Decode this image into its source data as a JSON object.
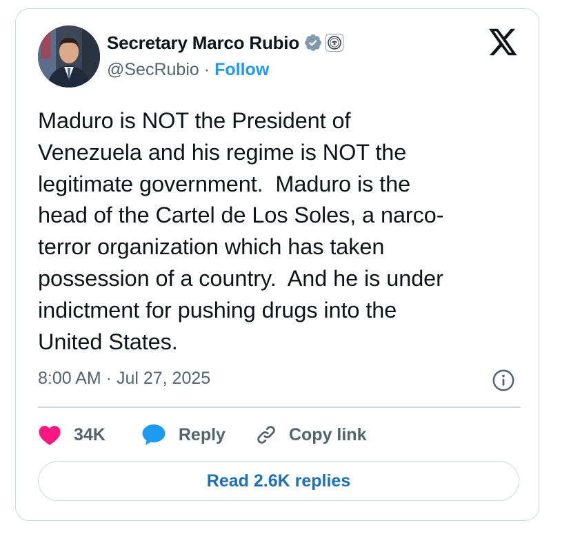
{
  "author": {
    "display_name": "Secretary Marco Rubio",
    "handle": "@SecRubio",
    "separator": "·",
    "follow_label": "Follow"
  },
  "tweet": {
    "text": "Maduro is NOT the President of\nVenezuela and his regime is NOT the\nlegitimate government.  Maduro is the\nhead of the Cartel de Los Soles, a narco-\nterror organization which has taken\npossession of a country.  And he is under\nindictment for pushing drugs into the\nUnited States.",
    "timestamp": "8:00 AM · Jul 27, 2025"
  },
  "actions": {
    "like_count": "34K",
    "reply_label": "Reply",
    "copy_link_label": "Copy link"
  },
  "footer": {
    "read_replies_label": "Read 2.6K replies"
  },
  "icons": {
    "verified": "verified-badge-icon",
    "affiliate": "state-department-seal-icon",
    "brand": "x-logo-icon",
    "info": "info-icon",
    "like": "heart-icon",
    "reply": "speech-bubble-icon",
    "copy": "link-icon"
  },
  "colors": {
    "accent": "#1d9bf0",
    "heart": "#f91880",
    "verified_badge": "#829aab",
    "muted_text": "#536471",
    "border": "#cfd9de"
  }
}
